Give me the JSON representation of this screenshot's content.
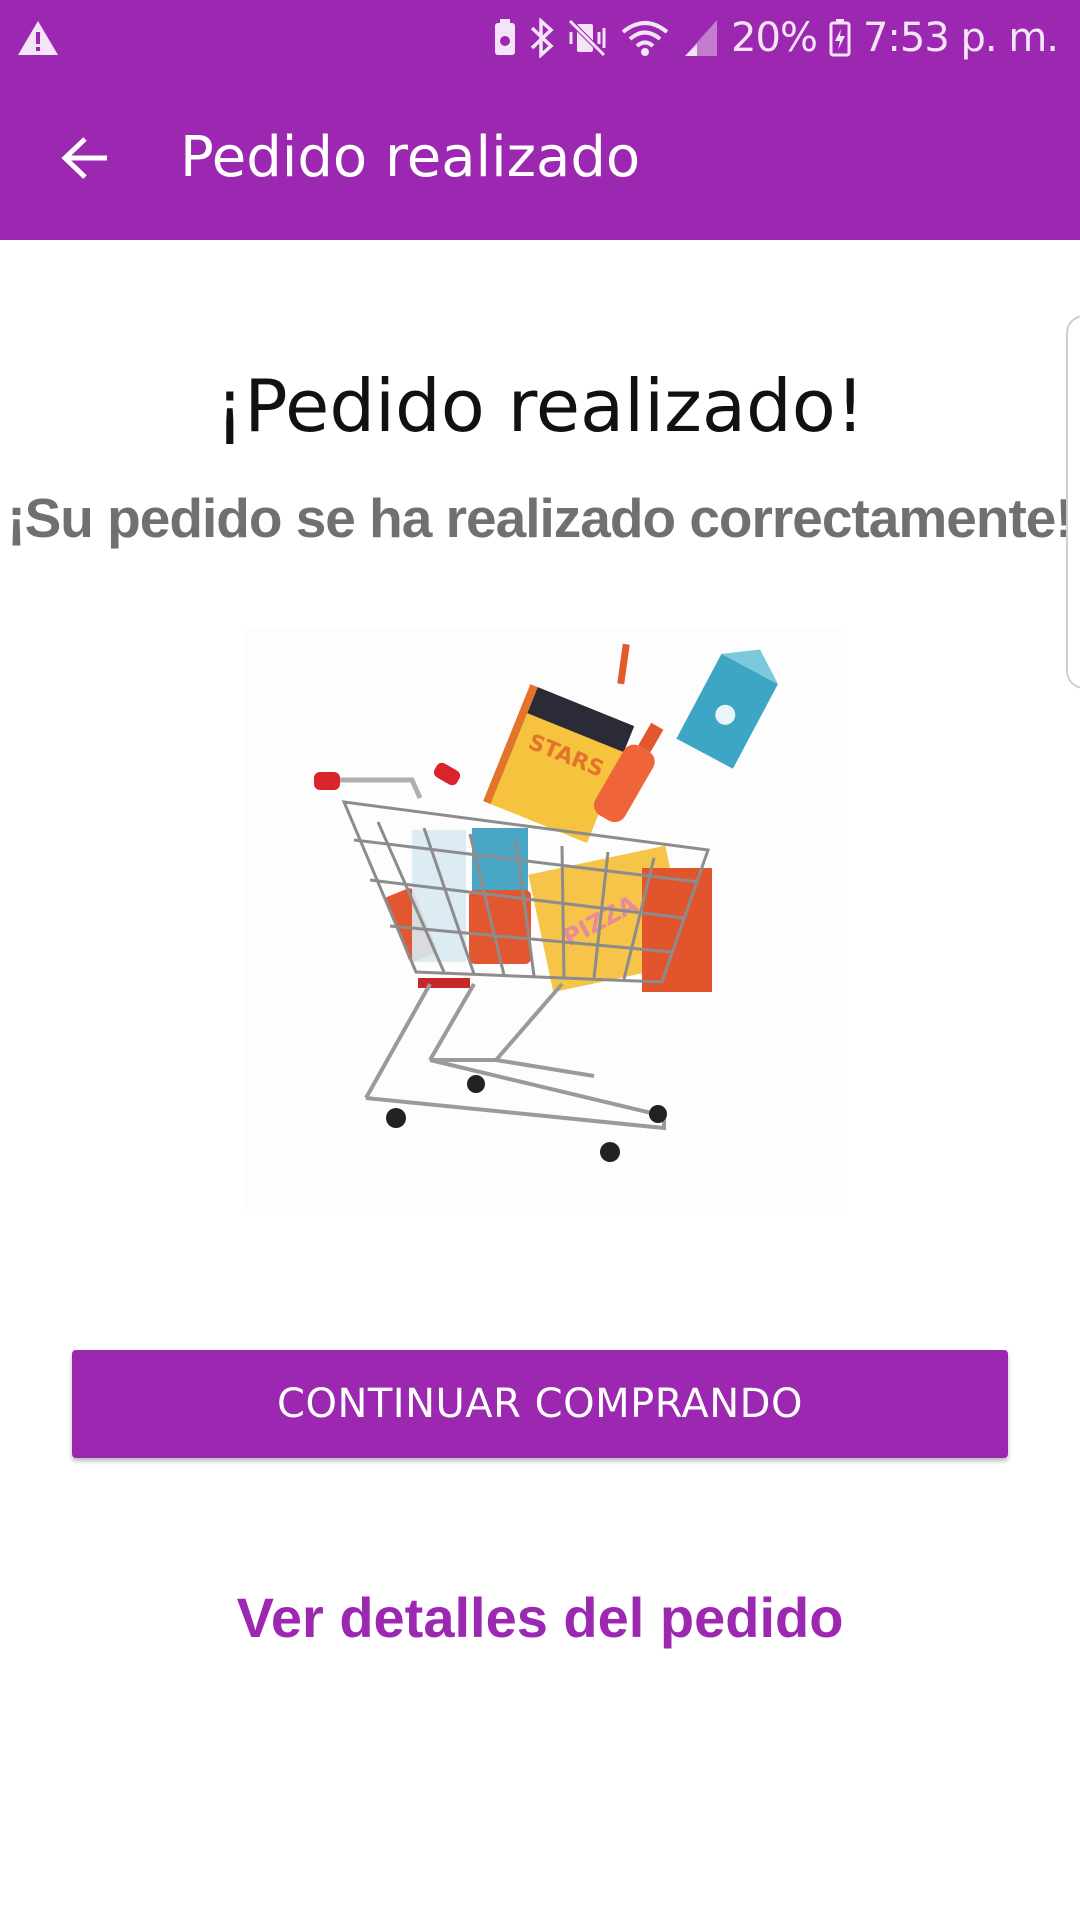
{
  "status_bar": {
    "battery_percent": "20%",
    "time": "7:53 p. m.",
    "icons": [
      "warning-icon",
      "storage-icon",
      "bluetooth-icon",
      "mute-icon",
      "wifi-icon",
      "signal-icon",
      "battery-icon"
    ]
  },
  "app_bar": {
    "title": "Pedido realizado",
    "back_icon": "arrow-left-icon"
  },
  "main": {
    "headline": "¡Pedido realizado!",
    "subheadline": "¡Su pedido se ha realizado correctamente!",
    "image": "shopping-cart-illustration",
    "image_text": [
      "STARS",
      "PIZZA"
    ]
  },
  "actions": {
    "continue_label": "CONTINUAR COMPRANDO",
    "details_label": "Ver detalles del pedido"
  },
  "colors": {
    "primary": "#9c27b0",
    "text_primary": "#111111",
    "text_secondary": "#707070",
    "background": "#ffffff"
  }
}
